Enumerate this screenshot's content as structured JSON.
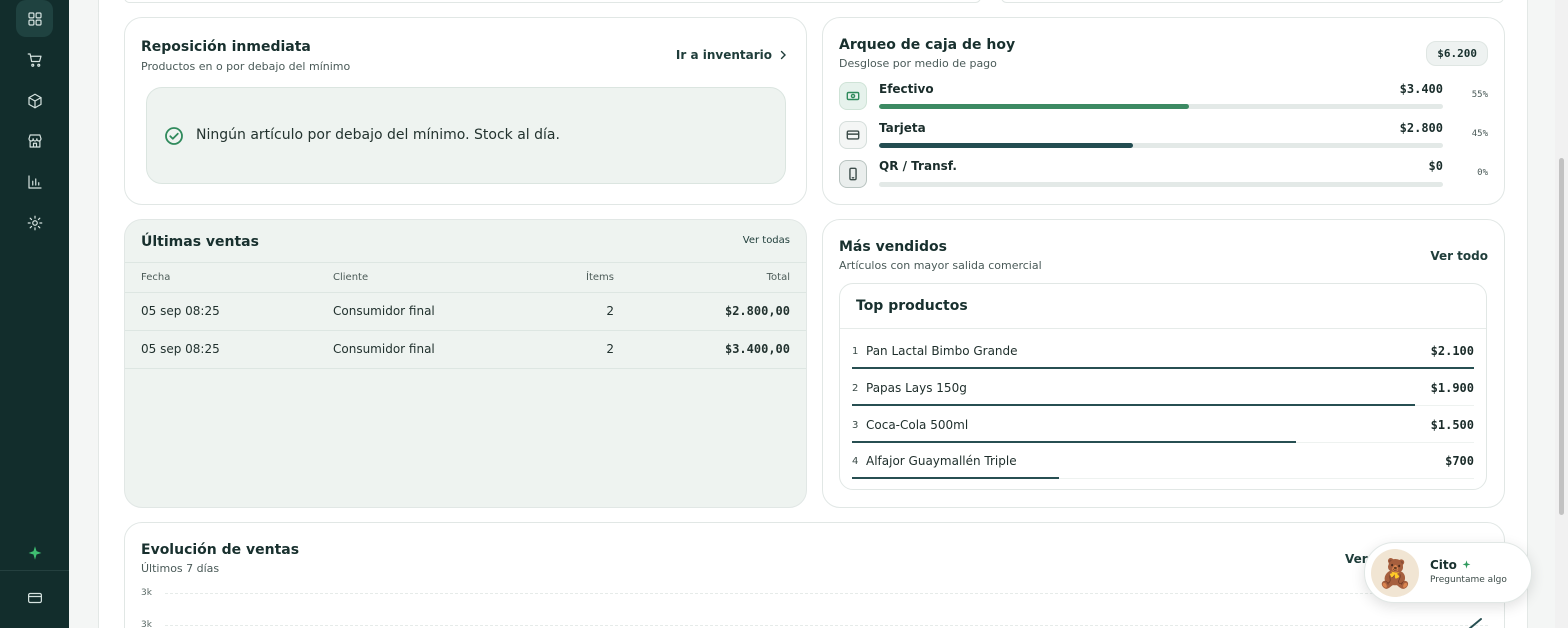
{
  "reposicion": {
    "title": "Reposición inmediata",
    "subtitle": "Productos en o por debajo del mínimo",
    "link": "Ir a inventario",
    "ok_message": "Ningún artículo por debajo del mínimo. Stock al día."
  },
  "arqueo": {
    "title": "Arqueo de caja de hoy",
    "subtitle": "Desglose por medio de pago",
    "total": "$6.200",
    "methods": [
      {
        "name": "Efectivo",
        "amount": "$3.400",
        "pct": "55%",
        "fill": 0.55,
        "color": "#3c8a63"
      },
      {
        "name": "Tarjeta",
        "amount": "$2.800",
        "pct": "45%",
        "fill": 0.45,
        "color": "#234d51"
      },
      {
        "name": "QR / Transf.",
        "amount": "$0",
        "pct": "0%",
        "fill": 0,
        "color": "#234d51"
      }
    ]
  },
  "ultimas": {
    "title": "Últimas ventas",
    "link": "Ver todas",
    "headers": {
      "fecha": "Fecha",
      "cliente": "Cliente",
      "items": "Ítems",
      "total": "Total"
    },
    "rows": [
      {
        "fecha": "05 sep 08:25",
        "cliente": "Consumidor final",
        "items": "2",
        "total": "$2.800,00"
      },
      {
        "fecha": "05 sep 08:25",
        "cliente": "Consumidor final",
        "items": "2",
        "total": "$3.400,00"
      }
    ]
  },
  "mas_vendidos": {
    "title": "Más vendidos",
    "subtitle": "Artículos con mayor salida comercial",
    "link": "Ver todo",
    "panel_title": "Top productos",
    "products": [
      {
        "rank": "1",
        "name": "Pan Lactal Bimbo Grande",
        "value": "$2.100",
        "fill": 1.0
      },
      {
        "rank": "2",
        "name": "Papas Lays 150g",
        "value": "$1.900",
        "fill": 0.905
      },
      {
        "rank": "3",
        "name": "Coca-Cola 500ml",
        "value": "$1.500",
        "fill": 0.714
      },
      {
        "rank": "4",
        "name": "Alfajor Guaymallén Triple",
        "value": "$700",
        "fill": 0.333
      }
    ]
  },
  "evolucion": {
    "title": "Evolución de ventas",
    "subtitle": "Últimos 7 días",
    "link": "Ver",
    "y_ticks": [
      "3k",
      "3k"
    ]
  },
  "assistant": {
    "name": "Cito",
    "subtitle": "Preguntame algo"
  },
  "icons": {
    "sidebar": [
      "dashboard-icon",
      "cart-icon",
      "box-icon",
      "store-icon",
      "chart-icon",
      "gear-icon",
      "sparkle-icon",
      "card-icon"
    ]
  }
}
